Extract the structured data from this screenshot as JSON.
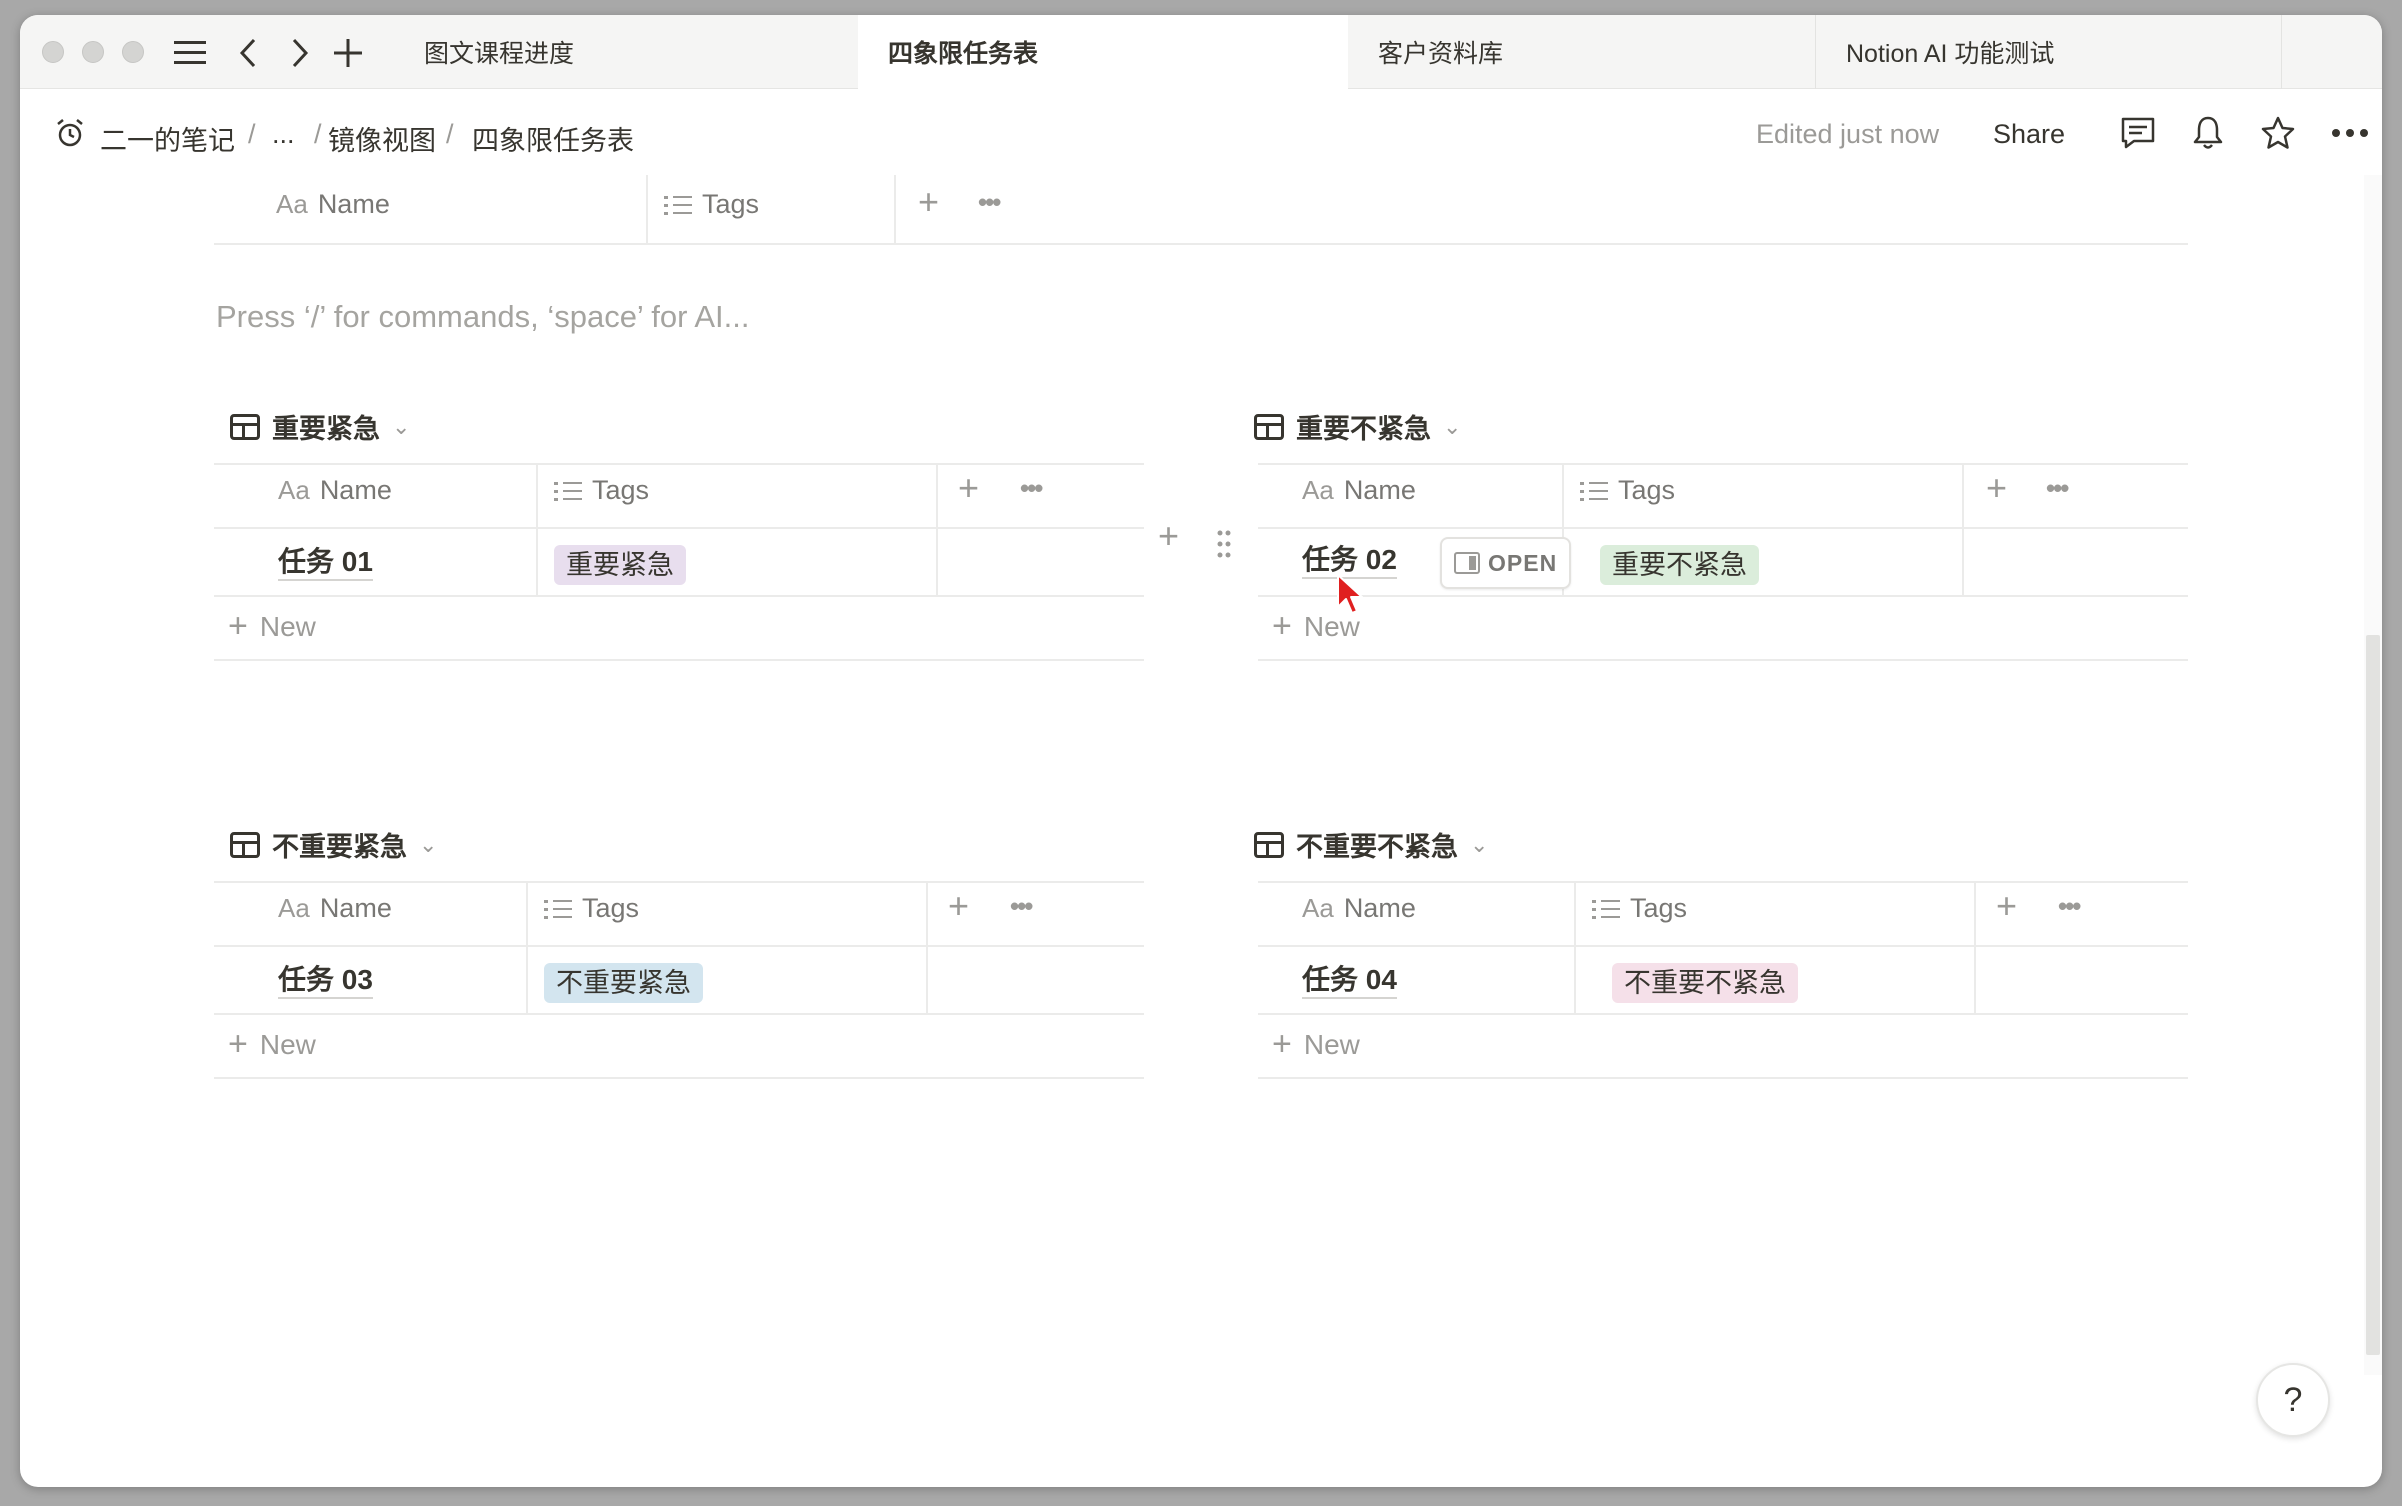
{
  "tabs": [
    {
      "label": "图文课程进度"
    },
    {
      "label": "四象限任务表"
    },
    {
      "label": "客户资料库"
    },
    {
      "label": "Notion AI 功能测试"
    }
  ],
  "breadcrumb": {
    "items": [
      "二一的笔记",
      "...",
      "镜像视图",
      "四象限任务表"
    ],
    "separator": "/"
  },
  "header": {
    "edited": "Edited just now",
    "share": "Share"
  },
  "top_table": {
    "col_name": "Name",
    "col_tags": "Tags",
    "aa": "Aa"
  },
  "placeholder": "Press ‘/’ for commands, ‘space’ for AI...",
  "views": [
    {
      "title": "重要紧急",
      "col_name": "Name",
      "col_tags": "Tags",
      "rows": [
        {
          "name": "任务 01",
          "tag": "重要紧急"
        }
      ],
      "new_label": "New",
      "tag_color": "#e8deee"
    },
    {
      "title": "重要不紧急",
      "col_name": "Name",
      "col_tags": "Tags",
      "rows": [
        {
          "name": "任务 02",
          "tag": "重要不紧急"
        }
      ],
      "new_label": "New",
      "open_label": "OPEN",
      "tag_color": "#dbeddb"
    },
    {
      "title": "不重要紧急",
      "col_name": "Name",
      "col_tags": "Tags",
      "rows": [
        {
          "name": "任务 03",
          "tag": "不重要紧急"
        }
      ],
      "new_label": "New",
      "tag_color": "#d3e5ef"
    },
    {
      "title": "不重要不紧急",
      "col_name": "Name",
      "col_tags": "Tags",
      "rows": [
        {
          "name": "任务 04",
          "tag": "不重要不紧急"
        }
      ],
      "new_label": "New",
      "tag_color": "#f5e0e9"
    }
  ],
  "icons": {
    "plus": "+",
    "more": "•••",
    "chevron": "⌄",
    "help": "?"
  }
}
